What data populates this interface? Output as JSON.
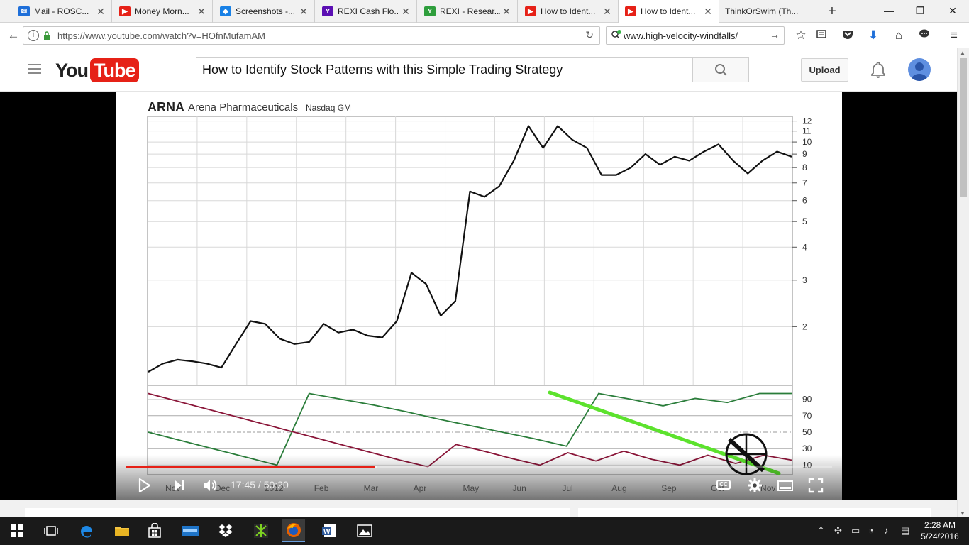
{
  "browser": {
    "tabs": [
      {
        "title": "Mail - ROSC...",
        "icon": "mail-icon"
      },
      {
        "title": "Money Morn...",
        "icon": "youtube-icon"
      },
      {
        "title": "Screenshots -...",
        "icon": "dropbox-icon"
      },
      {
        "title": "REXI Cash Flo...",
        "icon": "yahoo-icon"
      },
      {
        "title": "REXI - Resear...",
        "icon": "ycharts-icon"
      },
      {
        "title": "How to Ident...",
        "icon": "youtube-icon"
      },
      {
        "title": "How to Ident...",
        "icon": "youtube-icon",
        "active": true
      },
      {
        "title": "ThinkOrSwim (Th...",
        "icon": "none"
      }
    ],
    "url": "https://www.youtube.com/watch?v=HOfnMufamAM",
    "search_text": "www.high-velocity-windfalls/"
  },
  "youtube": {
    "logo_you": "You",
    "logo_tube": "Tube",
    "search_query": "How to Identify Stock Patterns with this Simple Trading Strategy",
    "upload_label": "Upload"
  },
  "player": {
    "current_time": "17:45",
    "duration": "50:20",
    "time_separator": " / ",
    "progress_fraction": 0.353,
    "cc_label": "CC"
  },
  "chart_data": [
    {
      "type": "line",
      "title": "ARNA",
      "subtitle": "Arena Pharmaceuticals",
      "exchange": "Nasdaq GM",
      "x_labels": [
        "Nov",
        "Dec",
        "2012",
        "Feb",
        "Mar",
        "Apr",
        "May",
        "Jun",
        "Jul",
        "Aug",
        "Sep",
        "Oct",
        "Nov"
      ],
      "y_scale": "log",
      "y_ticks": [
        2,
        3,
        4,
        5,
        6,
        7,
        8,
        9,
        10,
        11,
        12
      ],
      "series": [
        {
          "values": [
            1.35,
            1.45,
            1.5,
            1.48,
            1.45,
            1.4,
            1.72,
            2.1,
            2.05,
            1.8,
            1.72,
            1.75,
            2.05,
            1.9,
            1.95,
            1.85,
            1.82,
            2.1,
            3.2,
            2.9,
            2.2,
            2.5,
            6.5,
            6.2,
            6.8,
            8.5,
            11.5,
            9.5,
            11.5,
            10.2,
            9.5,
            7.5,
            7.5,
            8.0,
            9.0,
            8.2,
            8.8,
            8.5,
            9.2,
            9.8,
            8.5,
            7.6,
            8.5,
            9.2,
            8.8
          ]
        }
      ]
    },
    {
      "type": "line",
      "title": "",
      "y_ticks": [
        10,
        30,
        50,
        70,
        90
      ],
      "ylim": [
        0,
        100
      ],
      "series": [
        {
          "color": "#2a7d3a",
          "values": [
            50,
            40,
            30,
            20,
            10,
            97,
            90,
            83,
            75,
            66,
            58,
            50,
            42,
            33,
            97,
            90,
            82,
            91,
            86,
            97,
            97
          ]
        },
        {
          "color": "#8a1538",
          "values": [
            97,
            88,
            79,
            70,
            61,
            52,
            43,
            34,
            25,
            16,
            8,
            35,
            27,
            18,
            10,
            25,
            15,
            27,
            17,
            10,
            22,
            12,
            22,
            16
          ]
        }
      ],
      "annotation_line_color": "#5ce22d"
    }
  ],
  "taskbar": {
    "time": "2:28 AM",
    "date": "5/24/2016"
  }
}
